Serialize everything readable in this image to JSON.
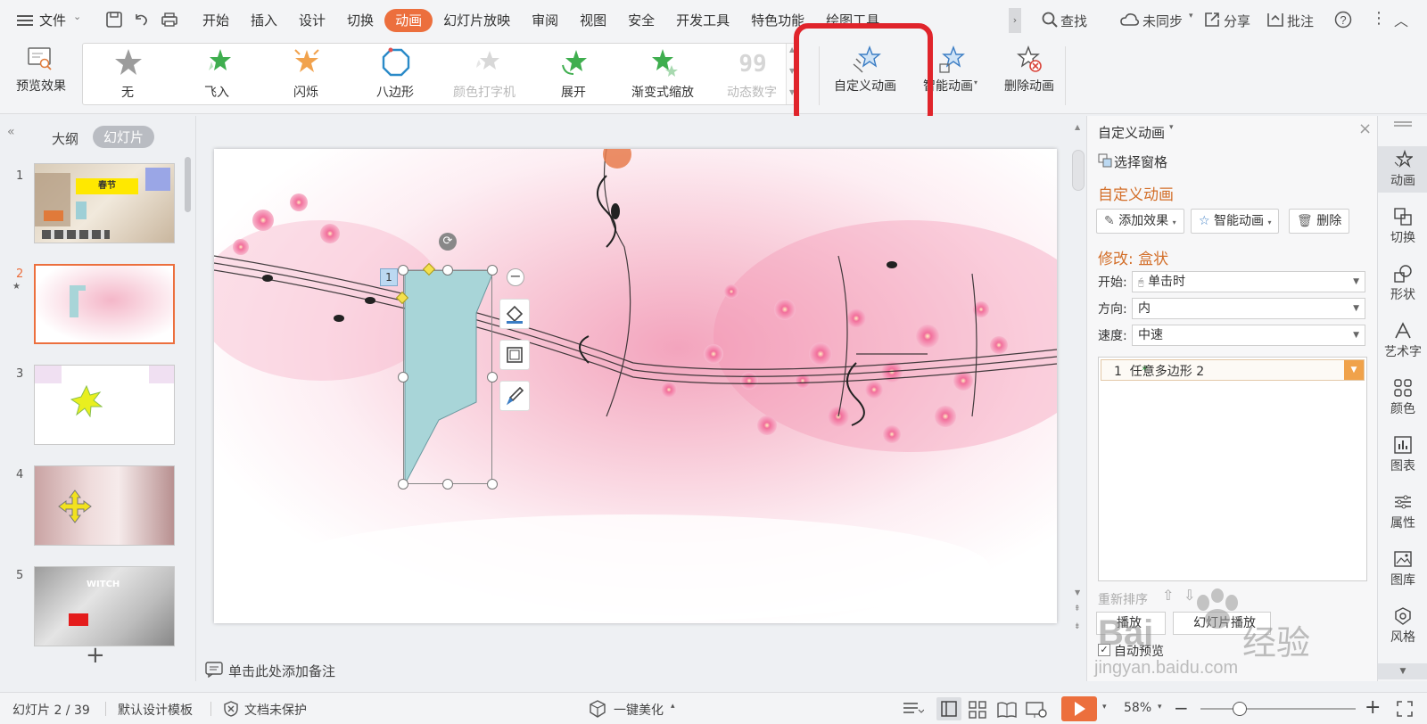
{
  "menubar": {
    "file_label": "文件",
    "tabs": [
      "开始",
      "插入",
      "设计",
      "切换",
      "动画",
      "幻灯片放映",
      "审阅",
      "视图",
      "安全",
      "开发工具",
      "特色功能",
      "绘图工具"
    ],
    "active_tab": "动画",
    "search_label": "查找",
    "sync_label": "未同步",
    "share_label": "分享",
    "review_label": "批注"
  },
  "ribbon": {
    "preview_label": "预览效果",
    "gallery": [
      {
        "label": "无",
        "icon": "star-gray-icon",
        "disabled": false
      },
      {
        "label": "飞入",
        "icon": "star-fly-icon",
        "disabled": false
      },
      {
        "label": "闪烁",
        "icon": "star-flash-icon",
        "disabled": false
      },
      {
        "label": "八边形",
        "icon": "octagon-icon",
        "disabled": false
      },
      {
        "label": "颜色打字机",
        "icon": "star-typewriter-icon",
        "disabled": true
      },
      {
        "label": "展开",
        "icon": "star-expand-icon",
        "disabled": false
      },
      {
        "label": "渐变式缩放",
        "icon": "star-zoom-icon",
        "disabled": false
      },
      {
        "label": "动态数字",
        "icon": "number-99-icon",
        "disabled": true
      }
    ],
    "custom_animation_label": "自定义动画",
    "smart_animation_label": "智能动画",
    "delete_animation_label": "删除动画",
    "highlight_color": "#e0242b"
  },
  "leftpanel": {
    "tab_outline": "大纲",
    "tab_slides": "幻灯片",
    "slides": [
      {
        "num": "1",
        "title_text": "春节"
      },
      {
        "num": "2"
      },
      {
        "num": "3"
      },
      {
        "num": "4"
      },
      {
        "num": "5",
        "title_text": "WITCH"
      }
    ],
    "add_label": "+"
  },
  "canvas": {
    "shape_index": "1",
    "notes_placeholder": "单击此处添加备注"
  },
  "taskpane": {
    "header": "自定义动画",
    "select_pane": "选择窗格",
    "section_title": "自定义动画",
    "add_effect": "添加效果",
    "smart_anim": "智能动画",
    "delete": "删除",
    "modify_title": "修改: 盒状",
    "start_label": "开始:",
    "start_value": "单击时",
    "direction_label": "方向:",
    "direction_value": "内",
    "speed_label": "速度:",
    "speed_value": "中速",
    "list_item": "1  任意多边形 2",
    "reorder_label": "重新排序",
    "play_label": "播放",
    "slideshow_label": "幻灯片播放",
    "auto_preview": "自动预览",
    "accent": "#d36f2a"
  },
  "rightbar": [
    "动画",
    "切换",
    "形状",
    "艺术字",
    "颜色",
    "图表",
    "属性",
    "图库",
    "风格"
  ],
  "statusbar": {
    "slide_info": "幻灯片 2 / 39",
    "template": "默认设计模板",
    "protect": "文档未保护",
    "beautify": "一键美化",
    "zoom": "58%"
  },
  "watermark": {
    "brand": "Bai",
    "brand2": "经验",
    "url": "jingyan.baidu.com"
  }
}
